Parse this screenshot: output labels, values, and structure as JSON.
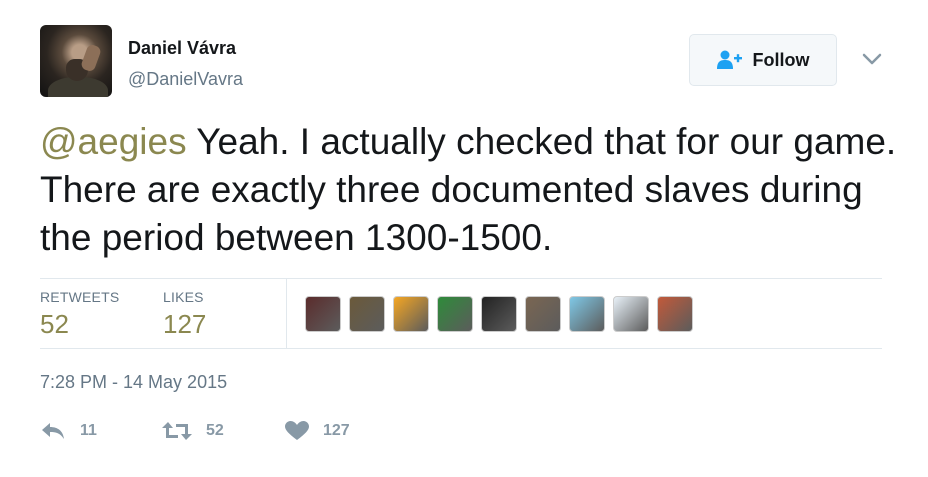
{
  "author": {
    "name": "Daniel Vávra",
    "handle": "@DanielVavra",
    "avatar_icon": "profile-photo"
  },
  "follow_button": {
    "label": "Follow",
    "icon": "add-user-icon"
  },
  "menu": {
    "icon": "chevron-down-icon"
  },
  "tweet": {
    "mention": "@aegies",
    "text": " Yeah. I actually checked that for our game. There are exactly three documented slaves during the period between 1300-1500."
  },
  "stats": {
    "retweets_label": "RETWEETS",
    "retweets_value": "52",
    "likes_label": "LIKES",
    "likes_value": "127"
  },
  "likers": [
    "#5b2c2c",
    "#6b5a3a",
    "#f5a623",
    "#2e8b3a",
    "#222222",
    "#7a6652",
    "#7fc8e6",
    "#e8f1f8",
    "#c25a3a"
  ],
  "timestamp": "7:28 PM - 14 May 2015",
  "actions": {
    "reply_count": "11",
    "retweet_count": "52",
    "like_count": "127"
  },
  "colors": {
    "accent": "#8b8850",
    "muted": "#657786",
    "divider": "#e1e8ed",
    "icon": "#8899a6"
  }
}
